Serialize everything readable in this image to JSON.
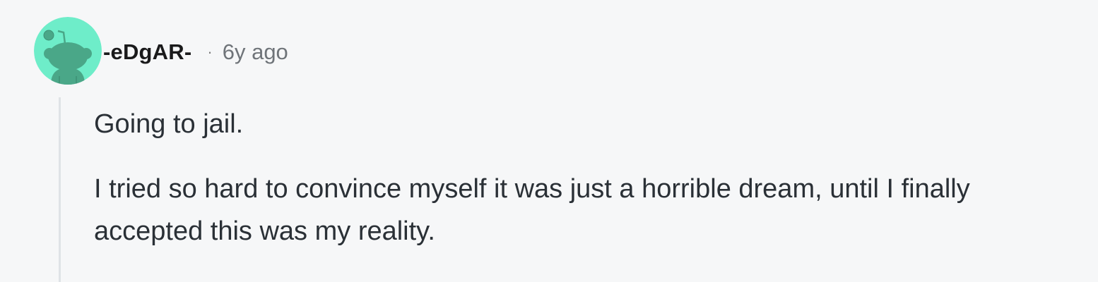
{
  "comment": {
    "author": "-eDgAR-",
    "separator": "·",
    "timestamp": "6y ago",
    "avatar_icon": "reddit-snoo-avatar-icon",
    "paragraphs": [
      "Going to jail.",
      "I tried so hard to convince myself it was just a horrible dream, until I finally accepted this was my reality."
    ]
  },
  "colors": {
    "background": "#f6f7f8",
    "avatar_bg": "#6eedc9",
    "avatar_figure": "#4aa788",
    "thread_line": "#dfe3e6",
    "username": "#1a1a1b",
    "timestamp": "#6f7479",
    "body_text": "#2a3036"
  }
}
